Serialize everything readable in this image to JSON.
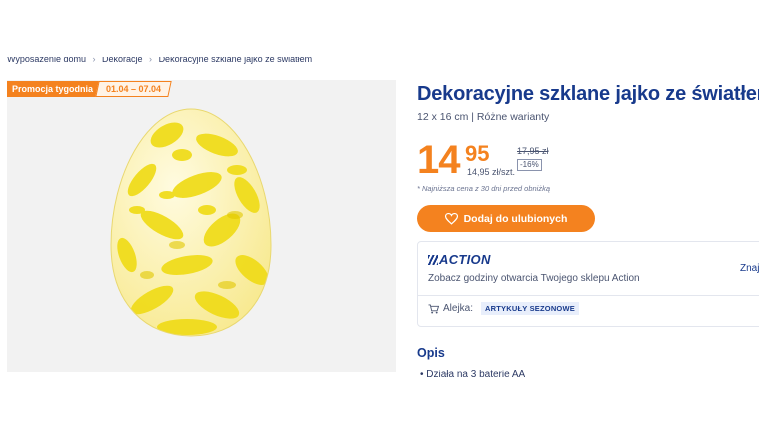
{
  "breadcrumb": [
    "Wyposażenie domu",
    "Dekoracje",
    "Dekoracyjne szklane jajko ze światłem"
  ],
  "promo": {
    "label": "Promocja tygodnia",
    "dates": "01.04 – 07.04"
  },
  "product": {
    "title": "Dekoracyjne szklane jajko ze światłem",
    "subtitle": "12 x 16 cm | Różne warianty",
    "price_int": "14",
    "price_dec": "95",
    "unit_price": "14,95 zł/szt.",
    "old_price": "17,95 zł",
    "discount": "-16%",
    "lowest_note": "* Najniższa cena z 30 dni przed obniżką",
    "favorite_label": "Dodaj do ulubionych"
  },
  "store": {
    "logo": "ACTION",
    "text": "Zobacz godziny otwarcia Twojego sklepu Action",
    "link": "Znaj",
    "aisle_label": "Alejka:",
    "aisle_value": "ARTYKUŁY SEZONOWE"
  },
  "description": {
    "heading": "Opis",
    "items": [
      "Działa na 3 baterie AA"
    ]
  },
  "colors": {
    "brand_blue": "#183a8c",
    "accent_orange": "#f4821f",
    "egg_yellow": "#f2e21f"
  },
  "icons": {
    "favorite": "heart-icon",
    "cart": "cart-icon"
  }
}
